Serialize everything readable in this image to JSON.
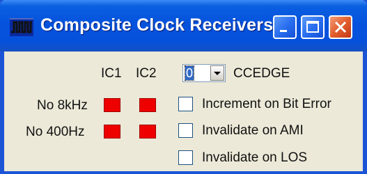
{
  "window": {
    "title": "Composite Clock Receivers",
    "title_icon": "waveform-icon",
    "buttons": {
      "minimize": "minimize-icon",
      "maximize": "maximize-icon",
      "close": "close-icon"
    }
  },
  "columns": {
    "ic1": "IC1",
    "ic2": "IC2"
  },
  "rows": [
    {
      "label": "No 8kHz",
      "ic1_color": "#ee0000",
      "ic2_color": "#ee0000"
    },
    {
      "label": "No 400Hz",
      "ic1_color": "#ee0000",
      "ic2_color": "#ee0000"
    }
  ],
  "ccedge": {
    "value": "0",
    "label": "CCEDGE"
  },
  "checkboxes": [
    {
      "label": "Increment on Bit Error",
      "checked": false
    },
    {
      "label": "Invalidate on AMI",
      "checked": false
    },
    {
      "label": "Invalidate on LOS",
      "checked": false
    }
  ],
  "colors": {
    "titlebar": "#0553dd",
    "body": "#ece9d8",
    "led_on": "#ee0000",
    "close_button": "#e35d2c"
  }
}
